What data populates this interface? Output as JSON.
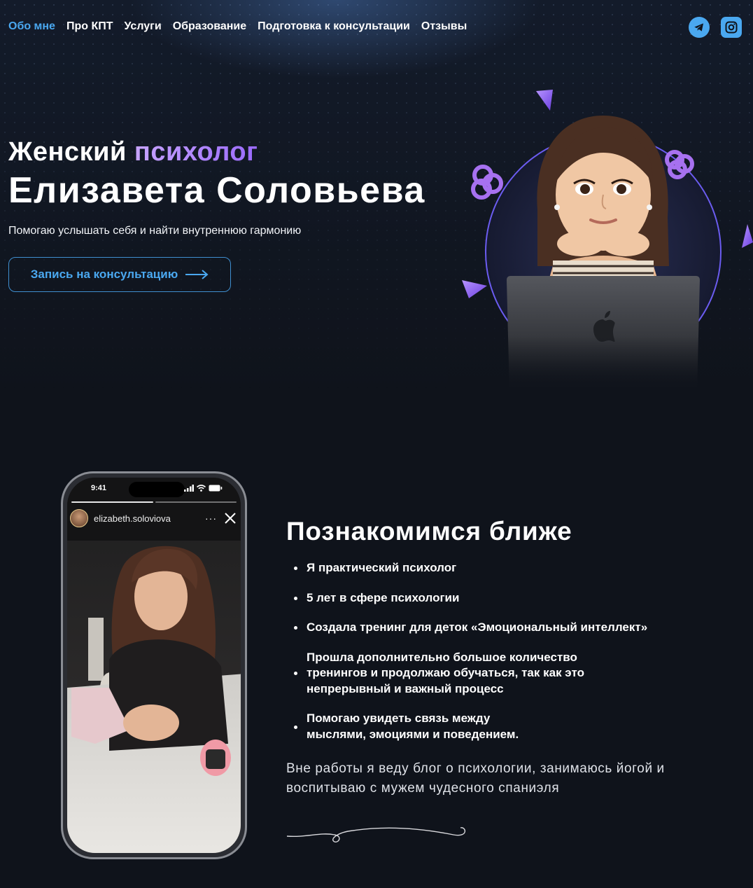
{
  "nav": {
    "items": [
      {
        "label": "Обо мне",
        "active": true
      },
      {
        "label": "Про КПТ",
        "active": false
      },
      {
        "label": "Услуги",
        "active": false
      },
      {
        "label": "Образование",
        "active": false
      },
      {
        "label": "Подготовка к консультации",
        "active": false
      },
      {
        "label": "Отзывы",
        "active": false
      }
    ],
    "social": [
      "telegram-icon",
      "instagram-icon"
    ]
  },
  "hero": {
    "subtitle_plain": "Женский",
    "subtitle_accent": "психолог",
    "name": "Елизавета Соловьева",
    "tagline": "Помогаю услышать себя и найти внутреннюю гармонию",
    "cta_label": "Запись на консультацию"
  },
  "phone": {
    "time": "9:41",
    "username": "elizabeth.soloviova",
    "more": "···"
  },
  "about": {
    "title": "Познакомимся ближе",
    "items": [
      "Я практический психолог",
      "5 лет в сфере психологии",
      "Создала тренинг для деток «Эмоциональный интеллект»",
      "Прошла дополнительно большое количество тренингов и продолжаю обучаться, так как это непрерывный и важный процесс",
      "Помогаю увидеть связь между мыслями, эмоциями и поведением."
    ],
    "note": "Вне работы я веду блог о психологии, занимаюсь йогой и воспитываю с мужем чудесного спаниэля"
  },
  "colors": {
    "background": "#0f131b",
    "accent_blue": "#4aa8f0",
    "accent_purple": "#9b6bff"
  }
}
